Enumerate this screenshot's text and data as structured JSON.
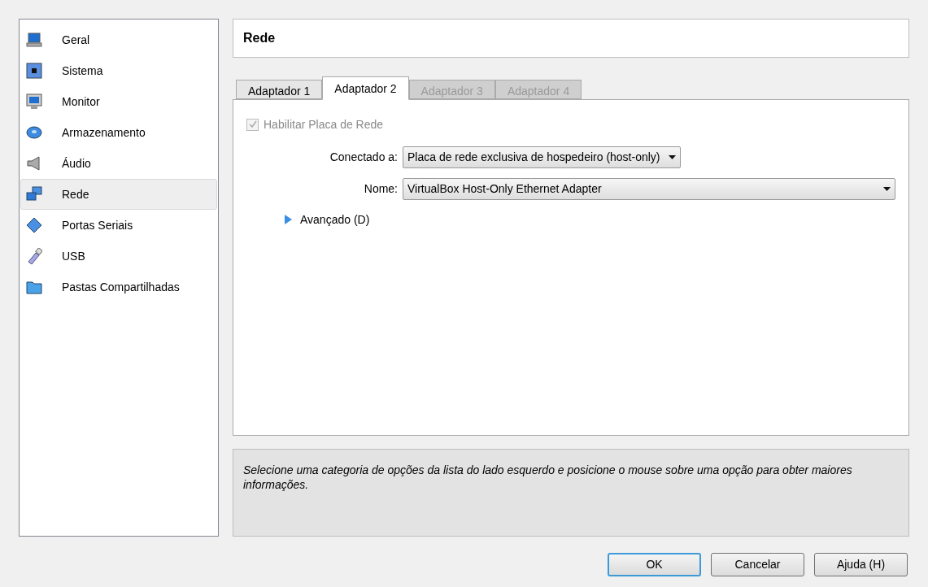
{
  "sidebar": {
    "items": [
      {
        "label": "Geral",
        "kind": "laptop",
        "selected": false
      },
      {
        "label": "Sistema",
        "kind": "chip",
        "selected": false
      },
      {
        "label": "Monitor",
        "kind": "monitor",
        "selected": false
      },
      {
        "label": "Armazenamento",
        "kind": "disk",
        "selected": false
      },
      {
        "label": "Áudio",
        "kind": "speaker",
        "selected": false
      },
      {
        "label": "Rede",
        "kind": "network",
        "selected": true
      },
      {
        "label": "Portas Seriais",
        "kind": "serial",
        "selected": false
      },
      {
        "label": "USB",
        "kind": "usb",
        "selected": false
      },
      {
        "label": "Pastas Compartilhadas",
        "kind": "folder",
        "selected": false
      }
    ]
  },
  "header": {
    "title": "Rede"
  },
  "tabs": [
    {
      "label": "Adaptador 1",
      "selected": false,
      "disabled": false
    },
    {
      "label": "Adaptador 2",
      "selected": true,
      "disabled": false
    },
    {
      "label": "Adaptador 3",
      "selected": false,
      "disabled": true
    },
    {
      "label": "Adaptador 4",
      "selected": false,
      "disabled": true
    }
  ],
  "enable_checkbox": {
    "label": "Habilitar Placa de Rede",
    "checked": true,
    "disabled": true
  },
  "fields": [
    {
      "label": "Conectado a:",
      "value": "Placa de rede exclusiva de hospedeiro (host-only)",
      "wide": false
    },
    {
      "label": "Nome:",
      "value": "VirtualBox Host-Only Ethernet Adapter",
      "wide": true
    }
  ],
  "advanced": {
    "label": "Avançado (D)",
    "expanded": false
  },
  "info": {
    "text": "Selecione uma categoria de opções da lista do lado esquerdo e posicione o mouse sobre uma opção para obter maiores informações."
  },
  "buttons": [
    {
      "label": "OK",
      "default": true
    },
    {
      "label": "Cancelar",
      "default": false
    },
    {
      "label": "Ajuda (H)",
      "default": false
    }
  ]
}
